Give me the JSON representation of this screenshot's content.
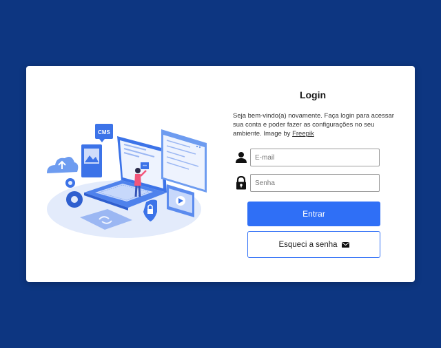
{
  "login": {
    "title": "Login",
    "intro_text": "Seja bem-vindo(a) novamente. Faça login para acessar sua conta e poder fazer as configurações no seu ambiente. Image by ",
    "intro_link": "Freepik",
    "email_placeholder": "E-mail",
    "password_placeholder": "Senha",
    "submit_label": "Entrar",
    "forgot_label": "Esqueci a senha"
  },
  "illustration": {
    "badge_text": "CMS"
  },
  "icons": {
    "email_field": "user-icon",
    "password_field": "lock-icon",
    "forgot_button": "envelope-icon"
  },
  "colors": {
    "background": "#0d3681",
    "card": "#ffffff",
    "primary": "#2f6ff6"
  }
}
